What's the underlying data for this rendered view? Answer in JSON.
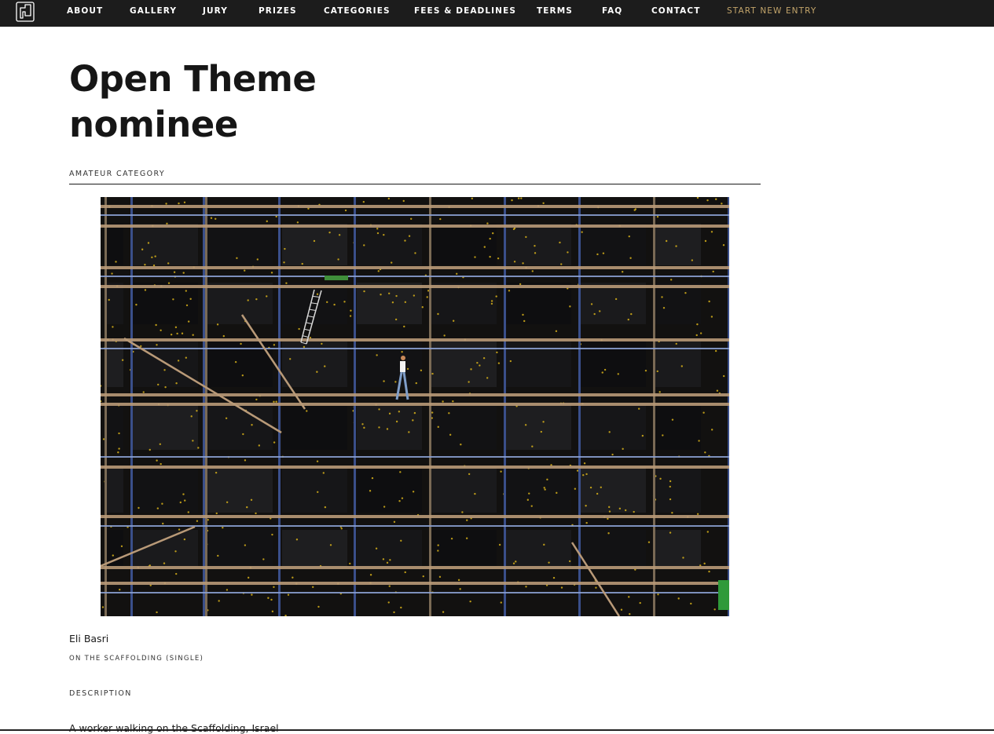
{
  "nav": {
    "logo_icon": "frame-logo-icon",
    "items": [
      "ABOUT",
      "GALLERY",
      "JURY",
      "PRIZES",
      "CATEGORIES",
      "FEES & DEADLINES",
      "TERMS",
      "FAQ",
      "CONTACT"
    ],
    "cta": "START NEW ENTRY",
    "cta_color": "#c2a46a",
    "background": "#1c1c1c"
  },
  "page": {
    "title_line1": "Open Theme",
    "title_line2": "nominee",
    "category": "AMATEUR CATEGORY"
  },
  "entry": {
    "image_subject": "building-scaffolding-photo",
    "author": "Eli Basri",
    "work_title": "ON THE SCAFFOLDING (SINGLE)",
    "description_label": "DESCRIPTION",
    "description": "A worker walking on the Scaffolding, Israel"
  }
}
